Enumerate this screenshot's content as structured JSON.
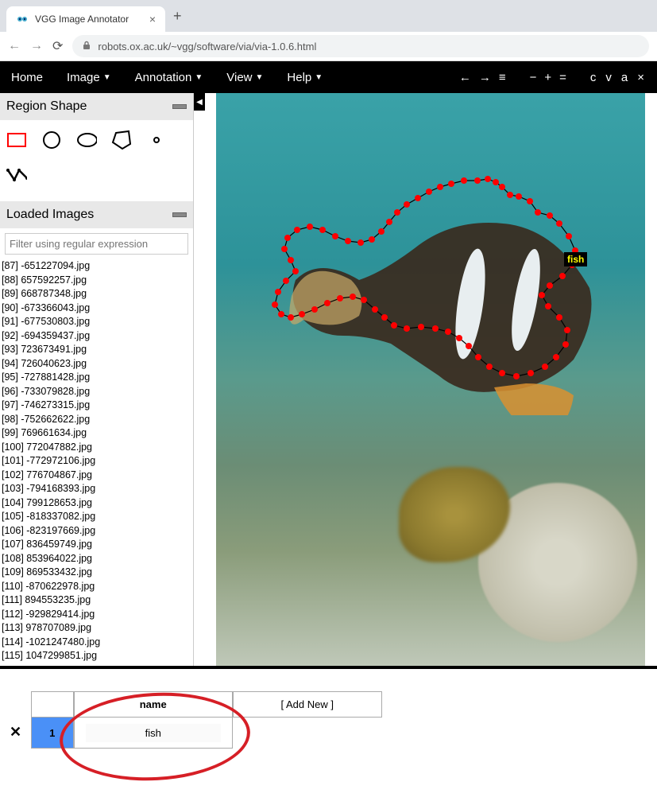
{
  "browser": {
    "tab_title": "VGG Image Annotator",
    "url": "robots.ox.ac.uk/~vgg/software/via/via-1.0.6.html"
  },
  "menu": {
    "items": [
      "Home",
      "Image",
      "Annotation",
      "View",
      "Help"
    ],
    "right_icons_nav": [
      "←",
      "→",
      "≡"
    ],
    "right_icons_zoom": [
      "−",
      "+",
      "="
    ],
    "right_icons_tools": [
      "c",
      "v",
      "a",
      "×"
    ]
  },
  "sidebar": {
    "region_shape_title": "Region Shape",
    "loaded_images_title": "Loaded Images",
    "filter_placeholder": "Filter using regular expression",
    "images": [
      "[87] -651227094.jpg",
      "[88] 657592257.jpg",
      "[89] 668787348.jpg",
      "[90] -673366043.jpg",
      "[91] -677530803.jpg",
      "[92] -694359437.jpg",
      "[93] 723673491.jpg",
      "[94] 726040623.jpg",
      "[95] -727881428.jpg",
      "[96] -733079828.jpg",
      "[97] -746273315.jpg",
      "[98] -752662622.jpg",
      "[99] 769661634.jpg",
      "[100] 772047882.jpg",
      "[101] -772972106.jpg",
      "[102] 776704867.jpg",
      "[103] -794168393.jpg",
      "[104] 799128653.jpg",
      "[105] -818337082.jpg",
      "[106] -823197669.jpg",
      "[107] 836459749.jpg",
      "[108] 853964022.jpg",
      "[109] 869533432.jpg",
      "[110] -870622978.jpg",
      "[111] 894553235.jpg",
      "[112] -929829414.jpg",
      "[113] 978707089.jpg",
      "[114] -1021247480.jpg",
      "[115] 1047299851.jpg"
    ]
  },
  "canvas": {
    "region_label": "fish"
  },
  "attributes": {
    "header_name": "name",
    "header_add": "[ Add New ]",
    "row_index": "1",
    "row_value": "fish"
  }
}
